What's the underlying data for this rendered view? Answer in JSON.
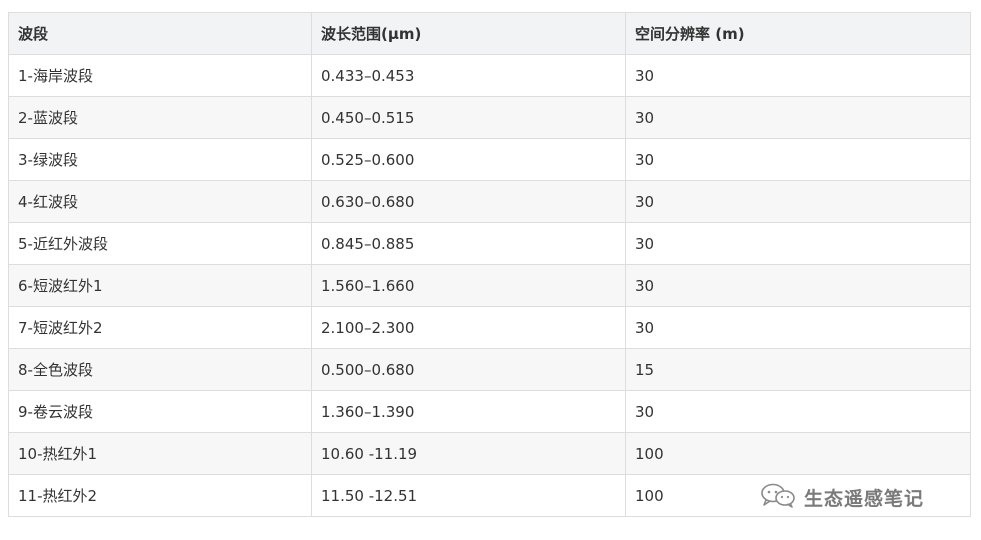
{
  "table": {
    "headers": [
      "波段",
      "波长范围(μm)",
      "空间分辨率 (m)"
    ],
    "rows": [
      [
        "1-海岸波段",
        "0.433–0.453",
        "30"
      ],
      [
        "2-蓝波段",
        "0.450–0.515",
        "30"
      ],
      [
        "3-绿波段",
        "0.525–0.600",
        "30"
      ],
      [
        "4-红波段",
        "0.630–0.680",
        "30"
      ],
      [
        "5-近红外波段",
        "0.845–0.885",
        "30"
      ],
      [
        "6-短波红外1",
        "1.560–1.660",
        "30"
      ],
      [
        "7-短波红外2",
        "2.100–2.300",
        "30"
      ],
      [
        "8-全色波段",
        "0.500–0.680",
        "15"
      ],
      [
        "9-卷云波段",
        "1.360–1.390",
        "30"
      ],
      [
        "10-热红外1",
        "10.60 -11.19",
        "100"
      ],
      [
        "11-热红外2",
        "11.50 -12.51",
        "100"
      ]
    ]
  },
  "watermark": {
    "text": "生态遥感笔记",
    "icon": "wechat-icon"
  },
  "colors": {
    "header_bg": "#f1f3f4",
    "stripe_bg": "#f7f7f7",
    "border": "#dddddd",
    "text": "#333333",
    "watermark": "#7a7a7a"
  }
}
